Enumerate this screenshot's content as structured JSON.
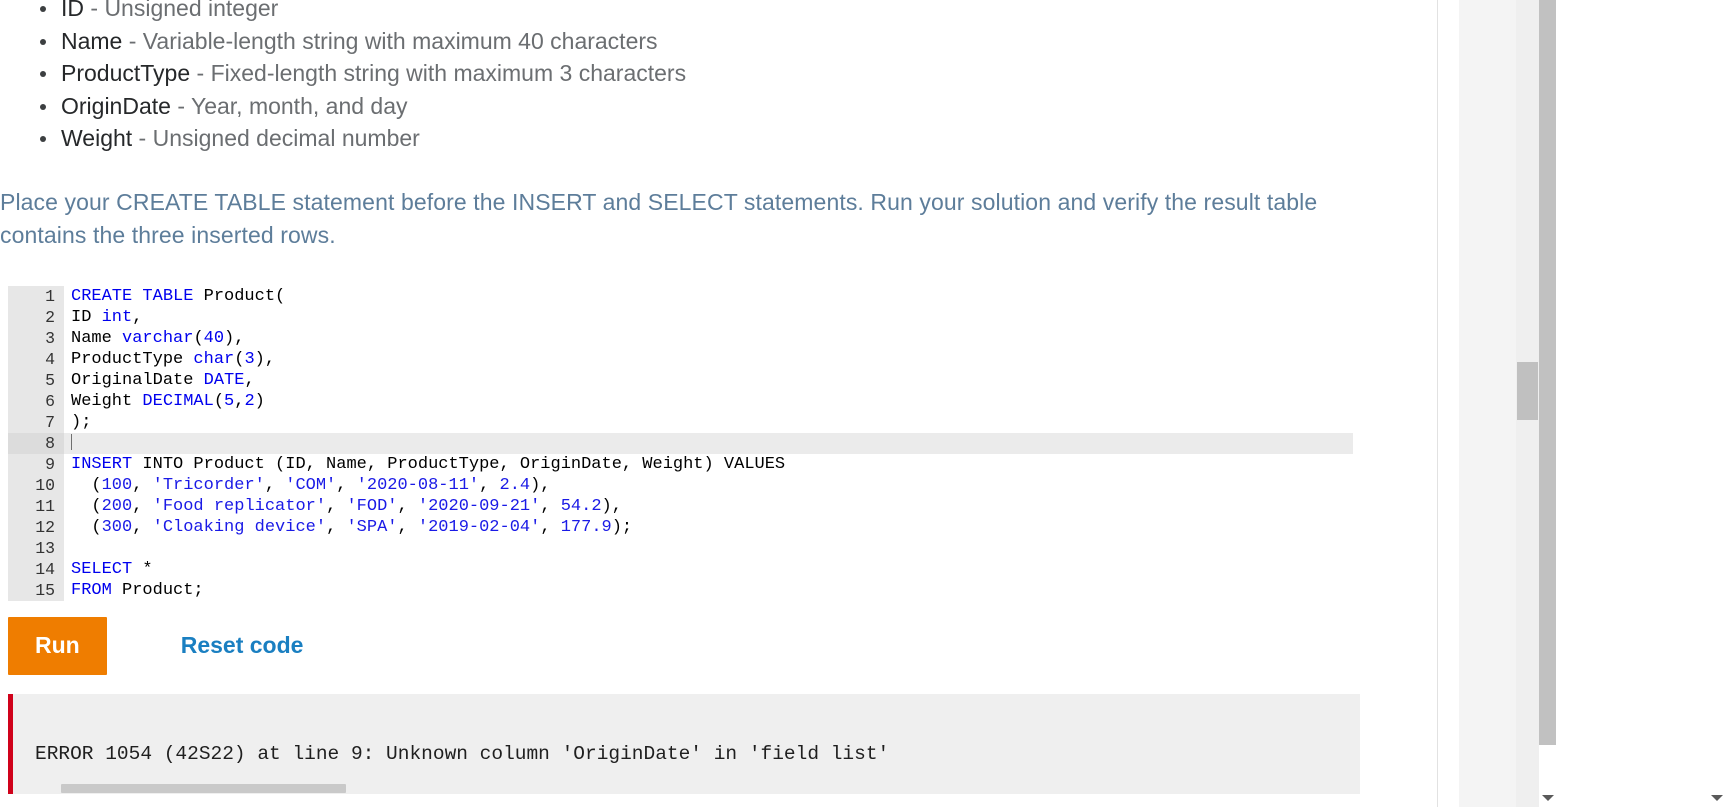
{
  "requirements": [
    {
      "term": "ID",
      "desc": " - Unsigned integer"
    },
    {
      "term": "Name",
      "desc": " - Variable-length string with maximum 40 characters"
    },
    {
      "term": "ProductType",
      "desc": " - Fixed-length string with maximum 3 characters"
    },
    {
      "term": "OriginDate",
      "desc": " - Year, month, and day"
    },
    {
      "term": "Weight",
      "desc": " - Unsigned decimal number"
    }
  ],
  "instructions": "Place your CREATE TABLE statement before the INSERT and SELECT statements. Run your solution and verify the result table contains the three inserted rows.",
  "editor": {
    "active_line": 8,
    "lines": [
      {
        "n": "1",
        "tokens": [
          {
            "t": "CREATE TABLE",
            "c": "kw"
          },
          {
            "t": " Product(",
            "c": "num"
          }
        ]
      },
      {
        "n": "2",
        "tokens": [
          {
            "t": "ID ",
            "c": "num"
          },
          {
            "t": "int",
            "c": "kw"
          },
          {
            "t": ",",
            "c": "num"
          }
        ]
      },
      {
        "n": "3",
        "tokens": [
          {
            "t": "Name ",
            "c": "num"
          },
          {
            "t": "varchar",
            "c": "kw"
          },
          {
            "t": "(",
            "c": "num"
          },
          {
            "t": "40",
            "c": "kw"
          },
          {
            "t": "),",
            "c": "num"
          }
        ]
      },
      {
        "n": "4",
        "tokens": [
          {
            "t": "ProductType ",
            "c": "num"
          },
          {
            "t": "char",
            "c": "kw"
          },
          {
            "t": "(",
            "c": "num"
          },
          {
            "t": "3",
            "c": "kw"
          },
          {
            "t": "),",
            "c": "num"
          }
        ]
      },
      {
        "n": "5",
        "tokens": [
          {
            "t": "OriginalDate ",
            "c": "num"
          },
          {
            "t": "DATE",
            "c": "kw"
          },
          {
            "t": ",",
            "c": "num"
          }
        ]
      },
      {
        "n": "6",
        "tokens": [
          {
            "t": "Weight ",
            "c": "num"
          },
          {
            "t": "DECIMAL",
            "c": "kw"
          },
          {
            "t": "(",
            "c": "num"
          },
          {
            "t": "5",
            "c": "kw"
          },
          {
            "t": ",",
            "c": "num"
          },
          {
            "t": "2",
            "c": "kw"
          },
          {
            "t": ")",
            "c": "num"
          }
        ]
      },
      {
        "n": "7",
        "tokens": [
          {
            "t": ");",
            "c": "num"
          }
        ]
      },
      {
        "n": "8",
        "tokens": []
      },
      {
        "n": "9",
        "tokens": [
          {
            "t": "INSERT",
            "c": "kw"
          },
          {
            "t": " INTO Product (ID, Name, ProductType, OriginDate, Weight) VALUES",
            "c": "num"
          }
        ]
      },
      {
        "n": "10",
        "tokens": [
          {
            "t": "  (",
            "c": "num"
          },
          {
            "t": "100",
            "c": "str"
          },
          {
            "t": ", ",
            "c": "num"
          },
          {
            "t": "'Tricorder'",
            "c": "str"
          },
          {
            "t": ", ",
            "c": "num"
          },
          {
            "t": "'COM'",
            "c": "str"
          },
          {
            "t": ", ",
            "c": "num"
          },
          {
            "t": "'2020-08-11'",
            "c": "str"
          },
          {
            "t": ", ",
            "c": "num"
          },
          {
            "t": "2.4",
            "c": "str"
          },
          {
            "t": "),",
            "c": "num"
          }
        ]
      },
      {
        "n": "11",
        "tokens": [
          {
            "t": "  (",
            "c": "num"
          },
          {
            "t": "200",
            "c": "str"
          },
          {
            "t": ", ",
            "c": "num"
          },
          {
            "t": "'Food replicator'",
            "c": "str"
          },
          {
            "t": ", ",
            "c": "num"
          },
          {
            "t": "'FOD'",
            "c": "str"
          },
          {
            "t": ", ",
            "c": "num"
          },
          {
            "t": "'2020-09-21'",
            "c": "str"
          },
          {
            "t": ", ",
            "c": "num"
          },
          {
            "t": "54.2",
            "c": "str"
          },
          {
            "t": "),",
            "c": "num"
          }
        ]
      },
      {
        "n": "12",
        "tokens": [
          {
            "t": "  (",
            "c": "num"
          },
          {
            "t": "300",
            "c": "str"
          },
          {
            "t": ", ",
            "c": "num"
          },
          {
            "t": "'Cloaking device'",
            "c": "str"
          },
          {
            "t": ", ",
            "c": "num"
          },
          {
            "t": "'SPA'",
            "c": "str"
          },
          {
            "t": ", ",
            "c": "num"
          },
          {
            "t": "'2019-02-04'",
            "c": "str"
          },
          {
            "t": ", ",
            "c": "num"
          },
          {
            "t": "177.9",
            "c": "str"
          },
          {
            "t": ");",
            "c": "num"
          }
        ]
      },
      {
        "n": "13",
        "tokens": []
      },
      {
        "n": "14",
        "tokens": [
          {
            "t": "SELECT",
            "c": "kw"
          },
          {
            "t": " *",
            "c": "num"
          }
        ]
      },
      {
        "n": "15",
        "tokens": [
          {
            "t": "FROM",
            "c": "kw"
          },
          {
            "t": " Product;",
            "c": "num"
          }
        ]
      }
    ]
  },
  "controls": {
    "run_label": "Run",
    "reset_label": "Reset code"
  },
  "output": {
    "error_text": "ERROR 1054 (42S22) at line 9: Unknown column 'OriginDate' in 'field list'"
  },
  "colors": {
    "run_button": "#ef7d00",
    "link": "#1a7fc1",
    "error_border": "#d0021b",
    "keyword": "#0000ee",
    "string": "#1a1ae6",
    "gutter": "#e7e7e7",
    "active_line": "#ebebeb",
    "panel_bg": "#efefef"
  }
}
